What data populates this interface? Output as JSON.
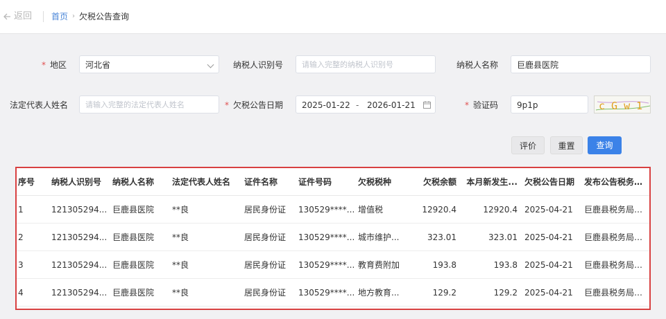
{
  "header": {
    "back_label": "返回",
    "breadcrumb_home": "首页",
    "breadcrumb_current": "欠税公告查询"
  },
  "form": {
    "region_label": "地区",
    "region_value": "河北省",
    "taxpayer_id_label": "纳税人识别号",
    "taxpayer_id_placeholder": "请输入完整的纳税人识别号",
    "taxpayer_name_label": "纳税人名称",
    "taxpayer_name_value": "巨鹿县医院",
    "legal_rep_label": "法定代表人姓名",
    "legal_rep_placeholder": "请输入完整的法定代表人姓名",
    "date_label": "欠税公告日期",
    "date_from": "2025-01-22",
    "date_sep": "-",
    "date_to": "2026-01-21",
    "captcha_label": "验证码",
    "captcha_value": "9p1p",
    "captcha_image_text": "c G w 1"
  },
  "buttons": {
    "rate": "评价",
    "reset": "重置",
    "query": "查询"
  },
  "colors": {
    "primary": "#3b82e8",
    "highlight_border": "#d84040",
    "required_mark": "#e05050"
  },
  "table": {
    "columns": [
      "序号",
      "纳税人识别号",
      "纳税人名称",
      "法定代表人姓名",
      "证件名称",
      "证件号码",
      "欠税税种",
      "欠税余额",
      "本月新发生...",
      "欠税公告日期",
      "发布公告税务机关"
    ],
    "rows": [
      [
        "1",
        "121305294...",
        "巨鹿县医院",
        "**良",
        "居民身份证",
        "130529****...",
        "增值税",
        "12920.4",
        "12920.4",
        "2025-04-21",
        "巨鹿县税务局第二..."
      ],
      [
        "2",
        "121305294...",
        "巨鹿县医院",
        "**良",
        "居民身份证",
        "130529****...",
        "城市维护...",
        "323.01",
        "323.01",
        "2025-04-21",
        "巨鹿县税务局第二..."
      ],
      [
        "3",
        "121305294...",
        "巨鹿县医院",
        "**良",
        "居民身份证",
        "130529****...",
        "教育费附加",
        "193.8",
        "193.8",
        "2025-04-21",
        "巨鹿县税务局第二..."
      ],
      [
        "4",
        "121305294...",
        "巨鹿县医院",
        "**良",
        "居民身份证",
        "130529****...",
        "地方教育...",
        "129.2",
        "129.2",
        "2025-04-21",
        "巨鹿县税务局第二..."
      ]
    ]
  }
}
